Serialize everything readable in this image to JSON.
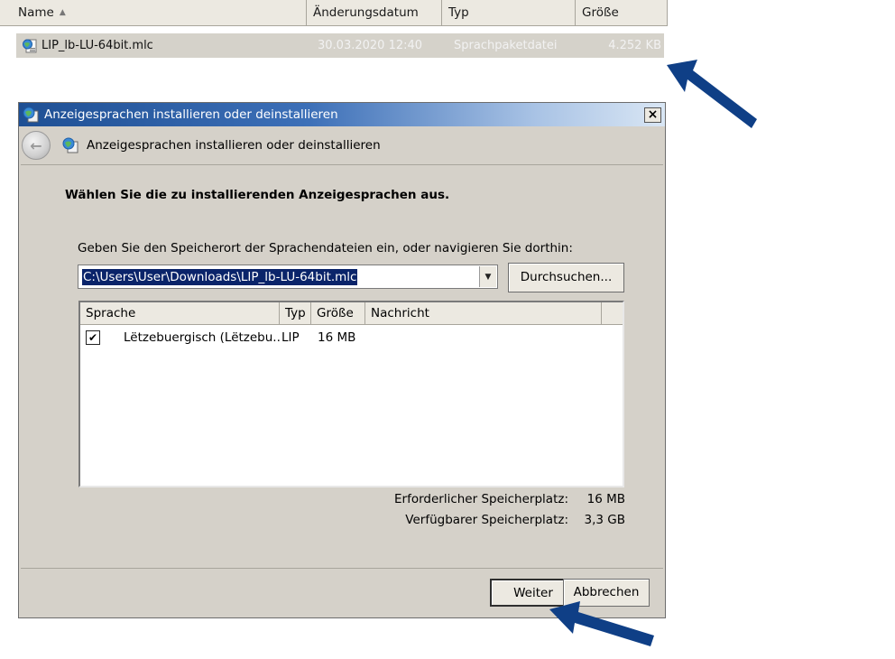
{
  "explorer": {
    "columns": {
      "name": "Name",
      "date": "Änderungsdatum",
      "type": "Typ",
      "size": "Größe"
    },
    "file": {
      "name": "LIP_lb-LU-64bit.mlc",
      "date": "30.03.2020 12:40",
      "type": "Sprachpaketdatei",
      "size": "4.252 KB"
    }
  },
  "dialog": {
    "title": "Anzeigesprachen installieren oder deinstallieren",
    "close_label": "×",
    "nav_title": "Anzeigesprachen installieren oder deinstallieren",
    "heading": "Wählen Sie die zu installierenden Anzeigesprachen aus.",
    "location_label": "Geben Sie den Speicherort der Sprachendateien ein, oder navigieren Sie dorthin:",
    "location_value": "C:\\Users\\User\\Downloads\\LIP_lb-LU-64bit.mlc",
    "browse_label": "Durchsuchen...",
    "list": {
      "headers": {
        "language": "Sprache",
        "type": "Typ",
        "size": "Größe",
        "message": "Nachricht"
      },
      "rows": [
        {
          "checked": true,
          "language": "Lëtzebuergisch (Lëtzebu...",
          "type": "LIP",
          "size": "16 MB",
          "message": ""
        }
      ]
    },
    "required_space_label": "Erforderlicher Speicherplatz:",
    "required_space_value": "16 MB",
    "available_space_label": "Verfügbarer Speicherplatz:",
    "available_space_value": "3,3 GB",
    "next_label": "Weiter",
    "cancel_label": "Abbrechen"
  },
  "colors": {
    "titlebar_start": "#1e4f94",
    "selection": "#0a246a",
    "arrow": "#0f3f86"
  }
}
